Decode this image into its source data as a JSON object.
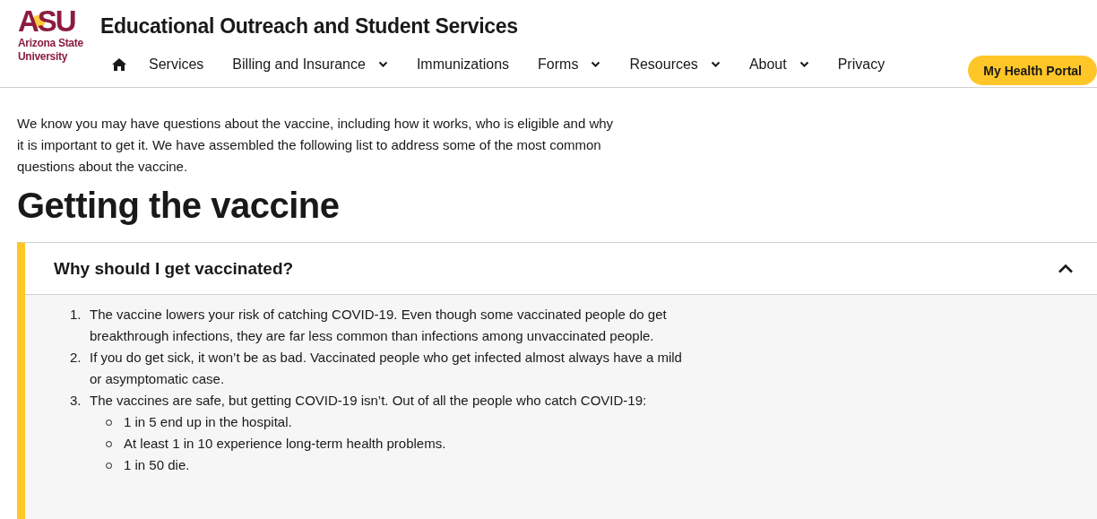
{
  "header": {
    "logo": {
      "mark": "ASU",
      "name_lines": [
        "Arizona State",
        "University"
      ]
    },
    "site_title": "Educational Outreach and Student Services",
    "nav": [
      {
        "kind": "home"
      },
      {
        "kind": "link",
        "label": "Services",
        "has_menu": false
      },
      {
        "kind": "link",
        "label": "Billing and Insurance",
        "has_menu": true
      },
      {
        "kind": "link",
        "label": "Immunizations",
        "has_menu": false
      },
      {
        "kind": "link",
        "label": "Forms",
        "has_menu": true
      },
      {
        "kind": "link",
        "label": "Resources",
        "has_menu": true
      },
      {
        "kind": "link",
        "label": "About",
        "has_menu": true
      },
      {
        "kind": "link",
        "label": "Privacy",
        "has_menu": false
      }
    ],
    "portal_button": "My Health Portal"
  },
  "intro": "We know you may have questions about the vaccine, including how it works, who is eligible and why it is important to get it. We have assembled the following list to address some of the most common questions about the vaccine.",
  "heading": "Getting the vaccine",
  "accordion": {
    "title": "Why should I get vaccinated?",
    "expanded": true,
    "items": [
      {
        "number": "1.",
        "text": "The vaccine lowers your risk of catching COVID-19. Even though some vaccinated people do get breakthrough infections, they are far less common than infections among unvaccinated people."
      },
      {
        "number": "2.",
        "text": "If you do get sick, it won’t be as bad. Vaccinated people who get infected almost always have a mild or asymptomatic case."
      },
      {
        "number": "3.",
        "text": "The vaccines are safe, but getting COVID-19 isn’t. Out of all the people who catch COVID-19:",
        "children": [
          {
            "text": "1 in 5 end up in the hospital."
          },
          {
            "text": "At least 1 in 10 experience long-term health problems."
          },
          {
            "text": "1 in 50 die."
          }
        ]
      }
    ]
  }
}
